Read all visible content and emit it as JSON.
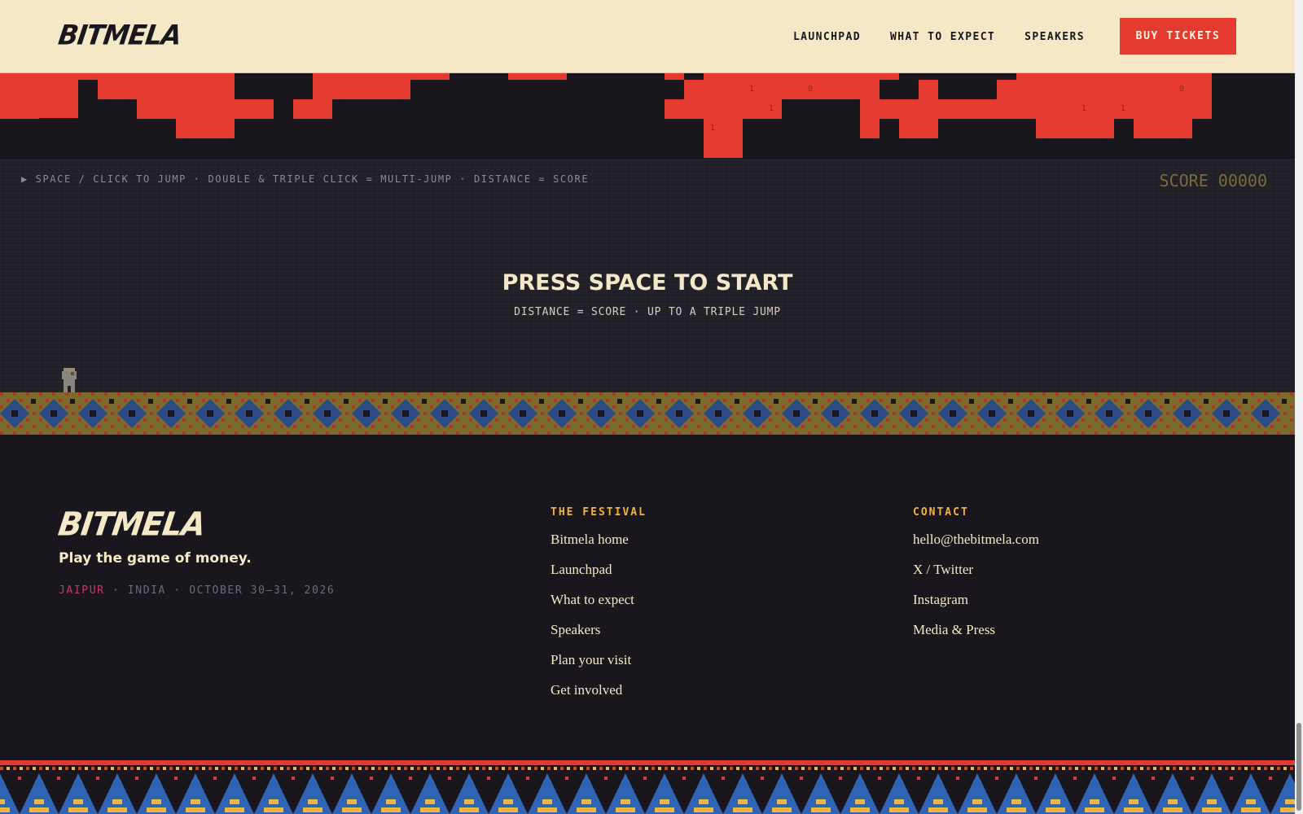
{
  "header": {
    "logo": "BITMELA",
    "nav": [
      "LAUNCHPAD",
      "WHAT TO EXPECT",
      "SPEAKERS"
    ],
    "cta": "BUY TICKETS"
  },
  "game": {
    "hint": "▶ SPACE / CLICK TO JUMP · DOUBLE & TRIPLE CLICK = MULTI-JUMP · DISTANCE = SCORE",
    "score": "SCORE 00000",
    "title": "PRESS SPACE TO START",
    "subtitle": "DISTANCE = SCORE · UP TO A TRIPLE JUMP",
    "skyline_digits": [
      "1",
      "0",
      "1",
      "1",
      "1",
      "1",
      "0"
    ]
  },
  "footer": {
    "logo": "BITMELA",
    "tagline": "Play the game of money.",
    "location": {
      "city": "JAIPUR",
      "rest": " · INDIA · OCTOBER 30–31, 2026"
    },
    "festival": {
      "heading": "THE FESTIVAL",
      "links": [
        "Bitmela home",
        "Launchpad",
        "What to expect",
        "Speakers",
        "Plan your visit",
        "Get involved"
      ]
    },
    "contact": {
      "heading": "CONTACT",
      "links": [
        "hello@thebitmela.com",
        "X / Twitter",
        "Instagram",
        "Media & Press"
      ]
    }
  },
  "colors": {
    "cream": "#f4e8c6",
    "dark": "#19161d",
    "red": "#e53a2f",
    "gold": "#f0b53a",
    "blue": "#2f64b5",
    "magenta": "#c4376a"
  }
}
